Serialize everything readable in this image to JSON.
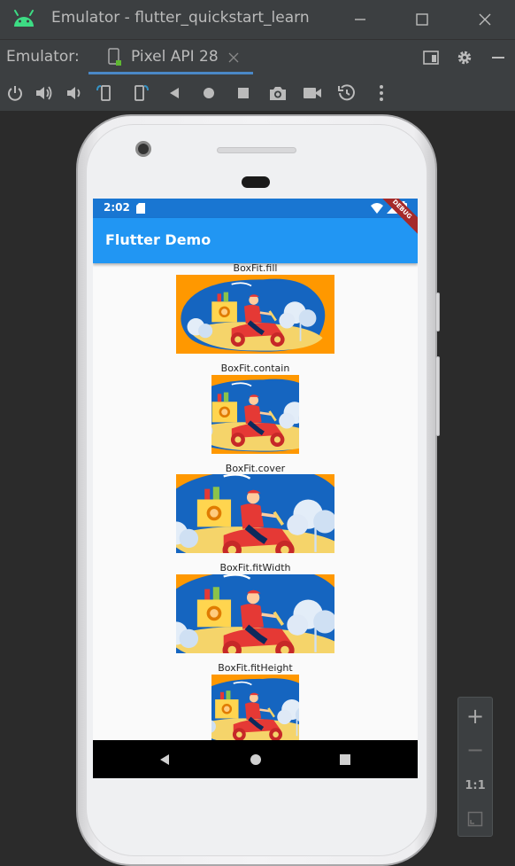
{
  "window": {
    "title": "Emulator - flutter_quickstart_learn",
    "app_icon": "android-icon",
    "controls": [
      "minimize-icon",
      "maximize-icon",
      "close-icon"
    ]
  },
  "tabbar": {
    "prefix": "Emulator:",
    "device_tab": "Pixel API 28",
    "right_icons": [
      "layout-icon",
      "settings-icon",
      "hide-icon"
    ]
  },
  "toolbar": {
    "icons": [
      "power-icon",
      "volume-up-icon",
      "volume-down-icon",
      "rotate-left-icon",
      "rotate-right-icon",
      "back-icon",
      "home-icon",
      "overview-icon",
      "screenshot-icon",
      "record-icon",
      "snapshot-icon",
      "more-icon"
    ]
  },
  "device": {
    "status_time": "2:02",
    "debug_banner": "DEBUG",
    "app_title": "Flutter Demo",
    "captions": [
      "BoxFit.fill",
      "BoxFit.contain",
      "BoxFit.cover",
      "BoxFit.fitWidth",
      "BoxFit.fitHeight"
    ],
    "nav_icons": [
      "nav-back-icon",
      "nav-home-icon",
      "nav-recents-icon"
    ]
  },
  "zoom_panel": {
    "zoom_in": "+",
    "zoom_out": "−",
    "actual_size": "1:1",
    "fit_icon": "fit-screen-icon"
  },
  "colors": {
    "image_bg": "#ff9800",
    "appbar": "#2196f3",
    "statusbar": "#1976d2"
  }
}
